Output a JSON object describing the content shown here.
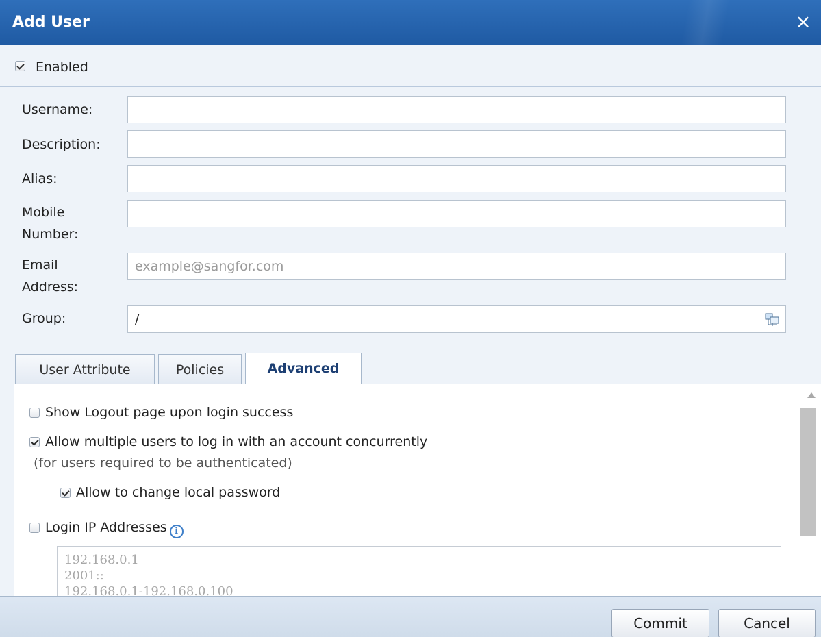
{
  "dialog": {
    "title": "Add User",
    "close_symbol": "×"
  },
  "enabled": {
    "label": "Enabled",
    "checked": true
  },
  "form": {
    "username_label": "Username:",
    "username_value": "",
    "description_label": "Description:",
    "description_value": "",
    "alias_label": "Alias:",
    "alias_value": "",
    "mobile_label_line1": "Mobile",
    "mobile_label_line2": "Number:",
    "mobile_value": "",
    "email_label_line1": "Email",
    "email_label_line2": "Address:",
    "email_placeholder": "example@sangfor.com",
    "group_label": "Group:",
    "group_value": "/"
  },
  "tabs": [
    {
      "label": "User Attribute",
      "active": false
    },
    {
      "label": "Policies",
      "active": false
    },
    {
      "label": "Advanced",
      "active": true
    }
  ],
  "advanced": {
    "show_logout_label": "Show Logout page upon login success",
    "show_logout_checked": false,
    "allow_multiple_label": "Allow multiple users to log in with an account concurrently",
    "allow_multiple_checked": true,
    "allow_multiple_note": "(for users required to be authenticated)",
    "change_password_label": "Allow to change local password",
    "change_password_checked": true,
    "login_ip_label": "Login IP Addresses",
    "login_ip_checked": false,
    "login_ip_placeholder": "192.168.0.1\n2001::\n192.168.0.1-192.168.0.100"
  },
  "footer": {
    "commit_label": "Commit",
    "cancel_label": "Cancel"
  }
}
